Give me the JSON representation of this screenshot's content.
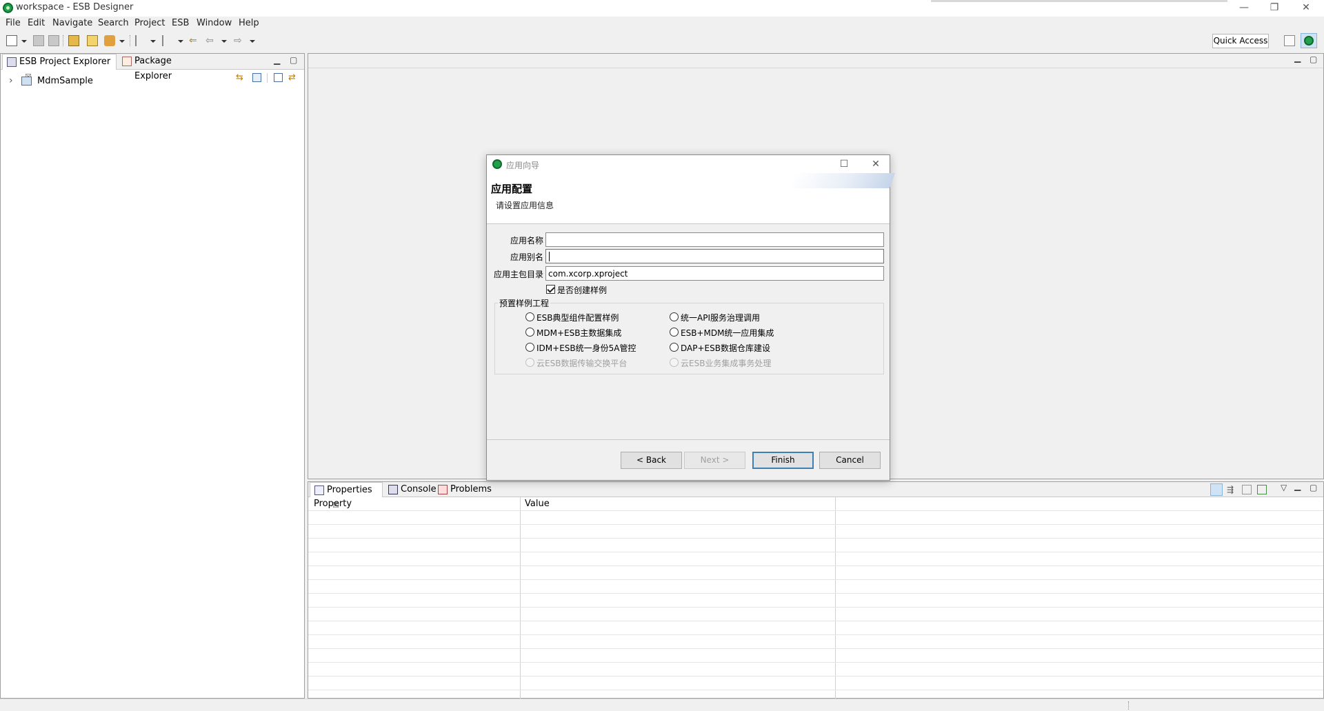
{
  "window": {
    "title": "workspace - ESB Designer",
    "controls": {
      "minimize": "—",
      "restore": "❐",
      "close": "✕"
    }
  },
  "menu": [
    "File",
    "Edit",
    "Navigate",
    "Search",
    "Project",
    "ESB",
    "Window",
    "Help"
  ],
  "toolbar": {
    "quick_access": "Quick Access"
  },
  "left_panel": {
    "tabs": [
      {
        "label": "ESB Project Explorer",
        "close": "☒"
      },
      {
        "label": "Package Explorer"
      }
    ],
    "tree": [
      {
        "label": "MdmSample",
        "expander": "›"
      }
    ]
  },
  "bottom_panel": {
    "tabs": [
      {
        "label": "Properties",
        "close": "☒"
      },
      {
        "label": "Console"
      },
      {
        "label": "Problems"
      }
    ],
    "columns": [
      "Property",
      "Value"
    ]
  },
  "dialog": {
    "title": "应用向导",
    "heading": "应用配置",
    "description": "请设置应用信息",
    "fields": {
      "app_name": {
        "label": "应用名称",
        "value": ""
      },
      "app_alias": {
        "label": "应用别名",
        "value": ""
      },
      "package_dir": {
        "label": "应用主包目录",
        "value": "com.xcorp.xproject"
      }
    },
    "create_sample": {
      "label": "是否创建样例",
      "checked": true
    },
    "group_title": "预置样例工程",
    "radios": [
      {
        "label": "ESB典型组件配置样例",
        "enabled": true
      },
      {
        "label": "统一API服务治理调用",
        "enabled": true
      },
      {
        "label": "MDM+ESB主数据集成",
        "enabled": true
      },
      {
        "label": "ESB+MDM统一应用集成",
        "enabled": true
      },
      {
        "label": "IDM+ESB统一身份5A管控",
        "enabled": true
      },
      {
        "label": "DAP+ESB数据仓库建设",
        "enabled": true
      },
      {
        "label": "云ESB数据传输交换平台",
        "enabled": false
      },
      {
        "label": "云ESB业务集成事务处理",
        "enabled": false
      }
    ],
    "buttons": {
      "back": "< Back",
      "next": "Next >",
      "finish": "Finish",
      "cancel": "Cancel"
    }
  },
  "colors": {
    "accent": "#3c7fb1",
    "app_icon": "#22a04b",
    "disabled_text": "#a0a0a0"
  }
}
